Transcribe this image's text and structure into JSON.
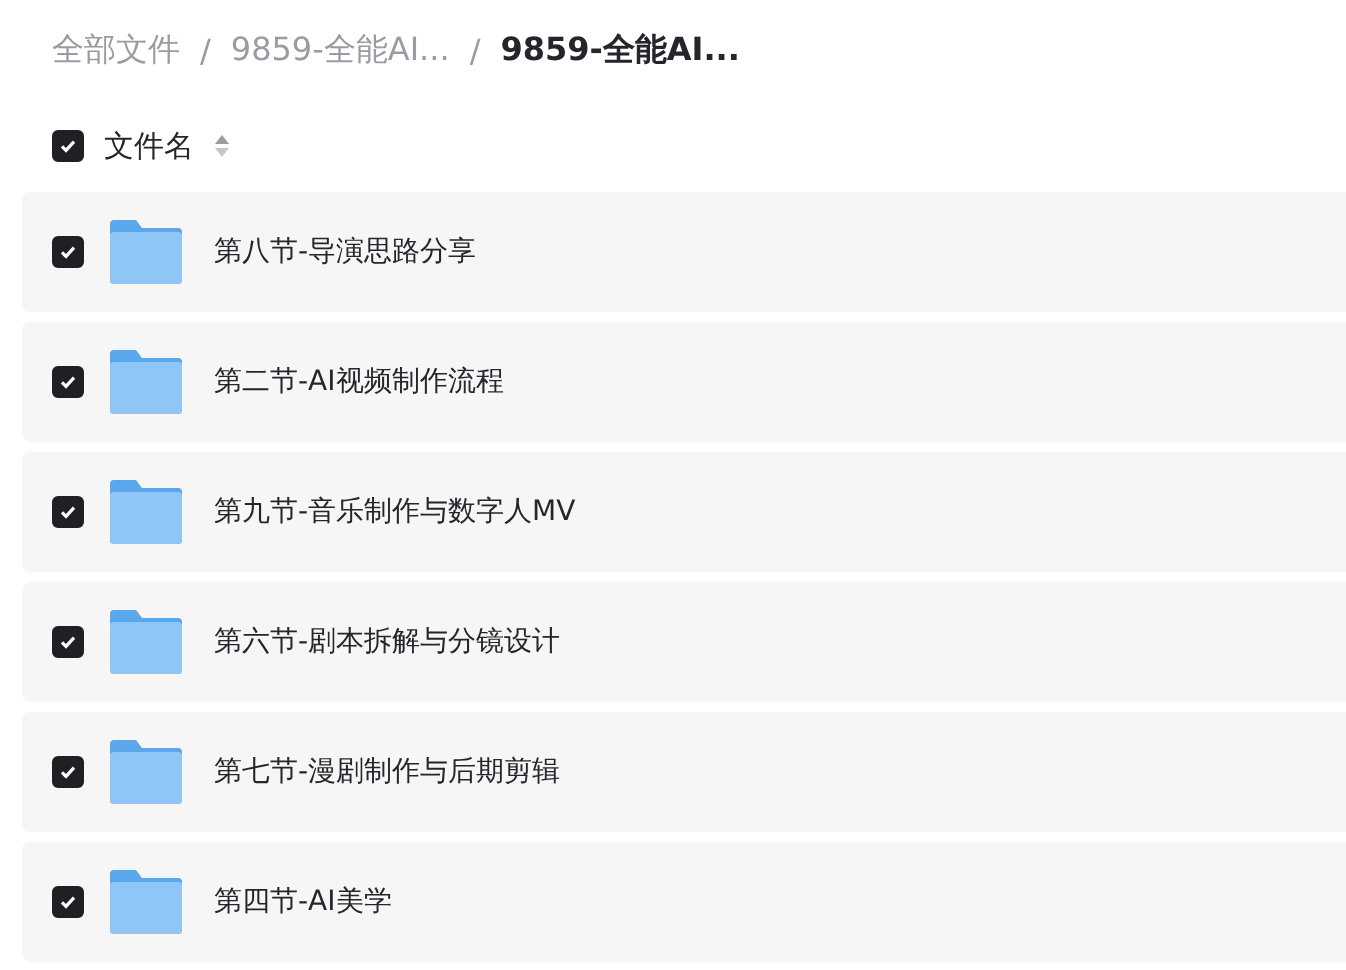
{
  "breadcrumb": [
    {
      "label": "全部文件",
      "current": false
    },
    {
      "label": "9859-全能AI...",
      "current": false
    },
    {
      "label": "9859-全能AI...",
      "current": true
    }
  ],
  "breadcrumb_separators": [
    "/",
    "/"
  ],
  "header": {
    "label": "文件名",
    "checked": true
  },
  "rows": [
    {
      "name": "第八节-导演思路分享",
      "checked": true
    },
    {
      "name": "第二节-AI视频制作流程",
      "checked": true
    },
    {
      "name": "第九节-音乐制作与数字人MV",
      "checked": true
    },
    {
      "name": "第六节-剧本拆解与分镜设计",
      "checked": true
    },
    {
      "name": "第七节-漫剧制作与后期剪辑",
      "checked": true
    },
    {
      "name": "第四节-AI美学",
      "checked": true
    }
  ]
}
